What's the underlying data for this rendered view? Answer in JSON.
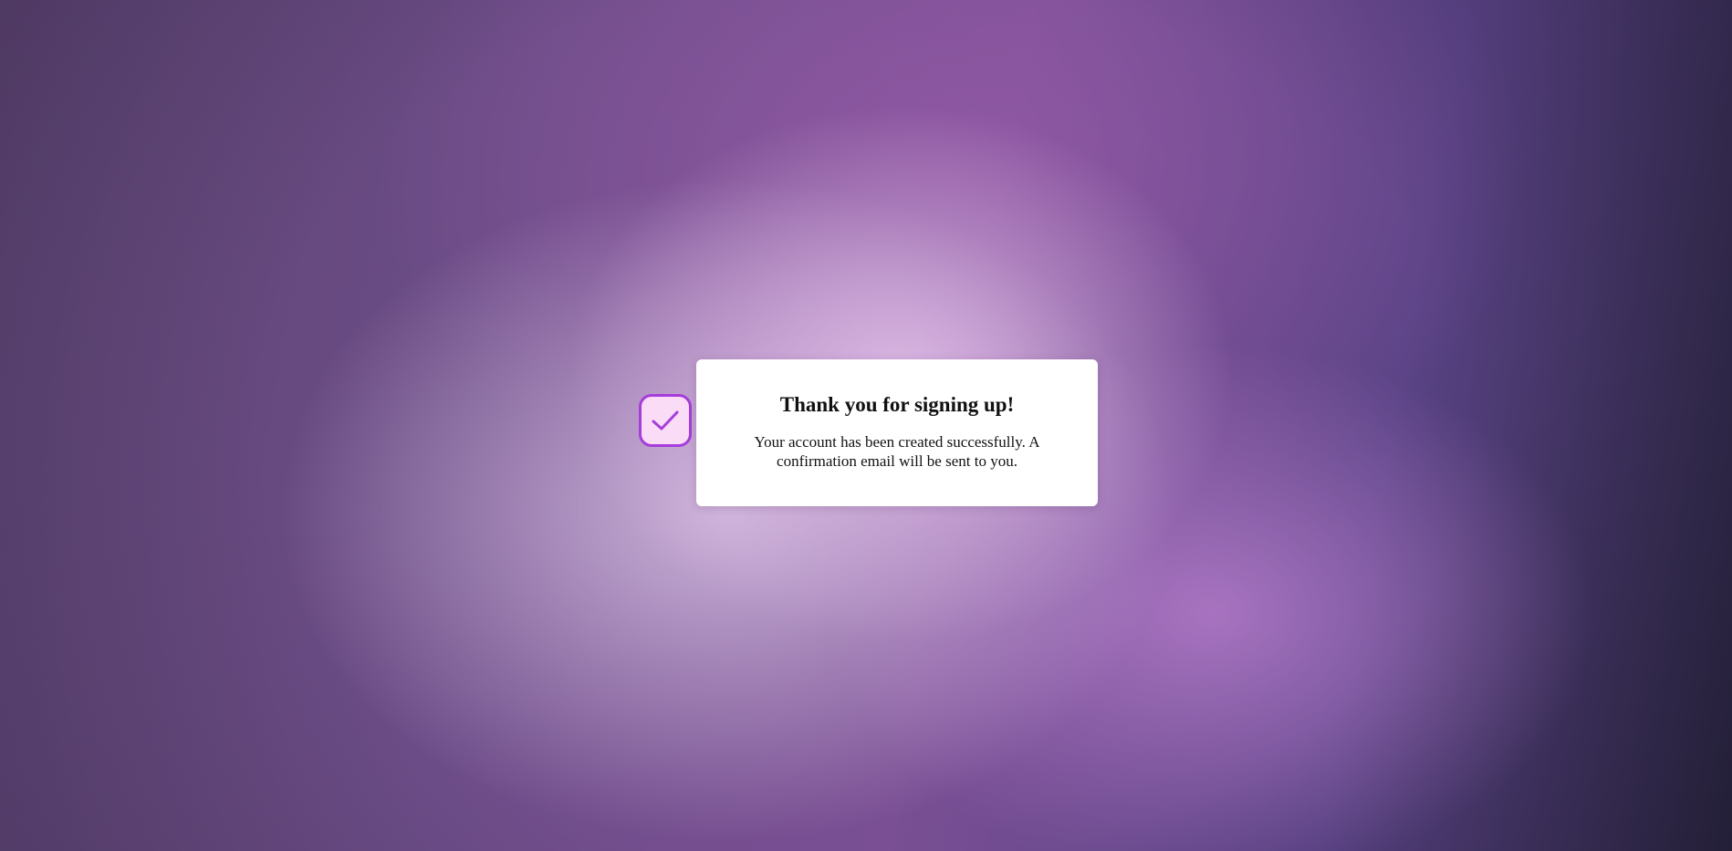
{
  "dialog": {
    "icon": "check-icon",
    "title": "Thank you for signing up!",
    "message": "Your account has been created successfully. A confirmation email will be sent to you."
  },
  "colors": {
    "accent": "#a53ddb",
    "badge_background": "#fbdcf7",
    "card_background": "#ffffff"
  }
}
